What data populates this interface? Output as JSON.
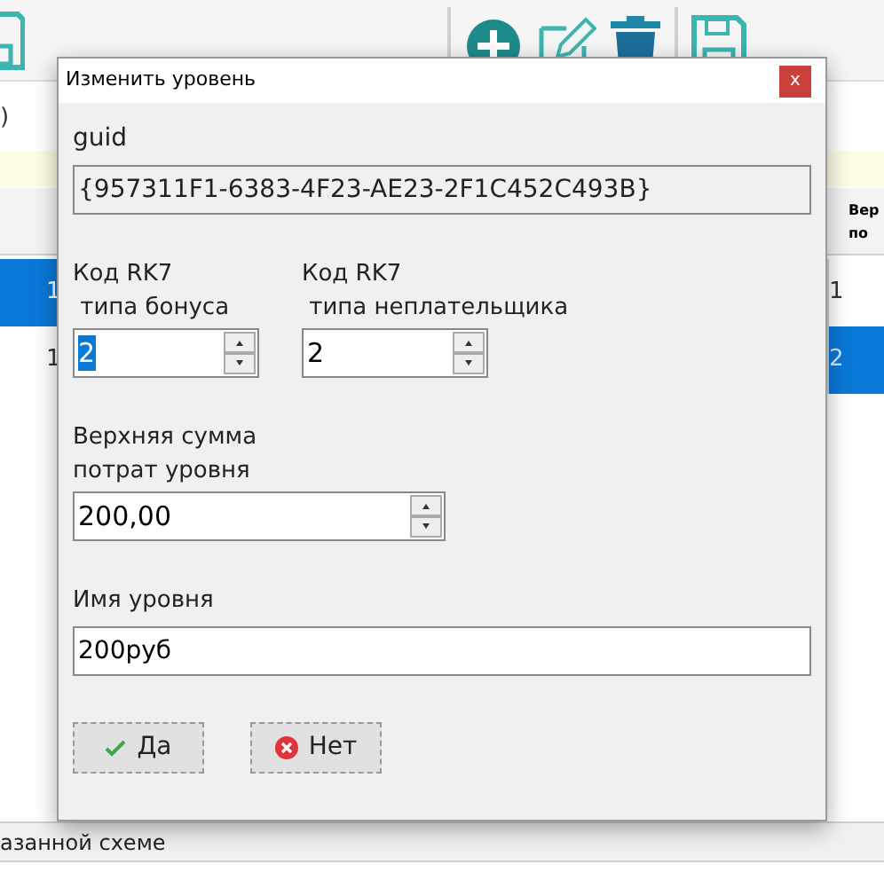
{
  "background": {
    "filter_value": ")",
    "left_rows": [
      {
        "cell": "1",
        "selected": true
      },
      {
        "cell": "1",
        "selected": false
      }
    ],
    "right_header": [
      "Вер",
      "по"
    ],
    "right_rows": [
      {
        "cell": "1",
        "selected": false
      },
      {
        "cell": "2",
        "selected": true
      }
    ],
    "status_bar": "азанной схеме"
  },
  "dialog": {
    "title": "Изменить уровень",
    "close": "x",
    "guid_label": "guid",
    "guid_value": "{957311F1-6383-4F23-AE23-2F1C452C493B}",
    "bonus_code": {
      "label_lines": [
        "Код RK7",
        " типа бонуса"
      ],
      "value": "2",
      "selected": true
    },
    "payer_code": {
      "label_lines": [
        "Код RK7",
        " типа неплательщика"
      ],
      "value": "2",
      "selected": false
    },
    "upper_sum": {
      "label_lines": [
        "Верхняя сумма",
        "потрат уровня"
      ],
      "value": "200,00"
    },
    "name": {
      "label": "Имя уровня",
      "value": "200руб"
    },
    "buttons": [
      {
        "kind": "ok",
        "label": "Да"
      },
      {
        "kind": "cancel",
        "label": "Нет"
      }
    ]
  }
}
